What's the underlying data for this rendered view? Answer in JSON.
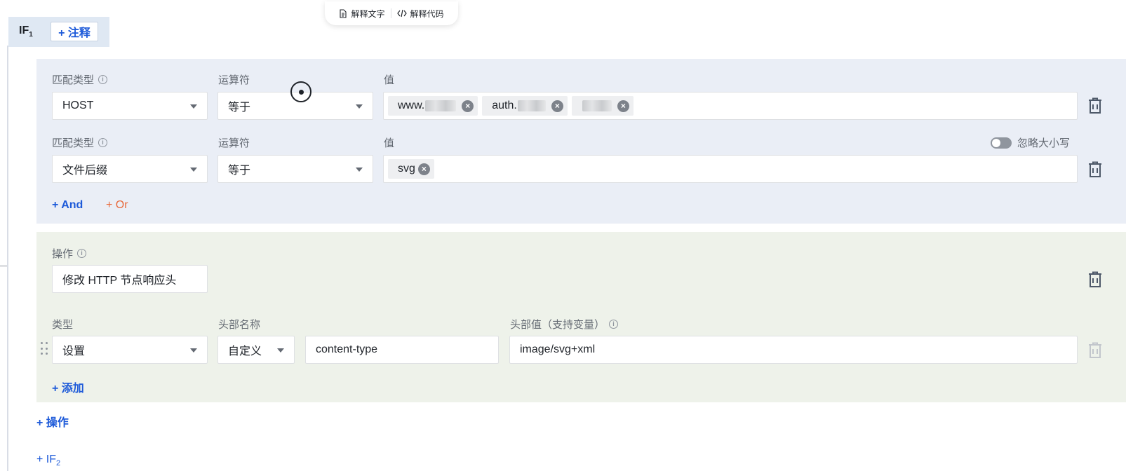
{
  "toolbar": {
    "explain_text": "解释文字",
    "explain_code": "解释代码"
  },
  "if_block": {
    "label": "IF",
    "index": "1",
    "note_button": "+ 注释"
  },
  "conditions": {
    "rows": [
      {
        "match_type_label": "匹配类型",
        "match_type_value": "HOST",
        "operator_label": "运算符",
        "operator_value": "等于",
        "value_label": "值",
        "tags": [
          {
            "text": "www."
          },
          {
            "text": "auth."
          },
          {
            "text": ""
          }
        ]
      },
      {
        "match_type_label": "匹配类型",
        "match_type_value": "文件后缀",
        "operator_label": "运算符",
        "operator_value": "等于",
        "value_label": "值",
        "ignore_case_label": "忽略大小写",
        "tags": [
          {
            "text": "svg"
          }
        ]
      }
    ],
    "and_link": "+ And",
    "or_link": "+ Or"
  },
  "action": {
    "label": "操作",
    "value": "修改 HTTP 节点响应头",
    "type_label": "类型",
    "type_value": "设置",
    "header_name_label": "头部名称",
    "header_name_mode": "自定义",
    "header_name_value": "content-type",
    "header_value_label": "头部值（支持变量）",
    "header_value_value": "image/svg+xml",
    "add_link": "+ 添加"
  },
  "add_action_link": "+ 操作",
  "add_if": {
    "label": "+ IF",
    "index": "2"
  },
  "colors": {
    "primary": "#1d5ad9",
    "or_accent": "#e86a3c",
    "condition_bg": "#eaeef6",
    "action_bg": "#eef2ea"
  }
}
